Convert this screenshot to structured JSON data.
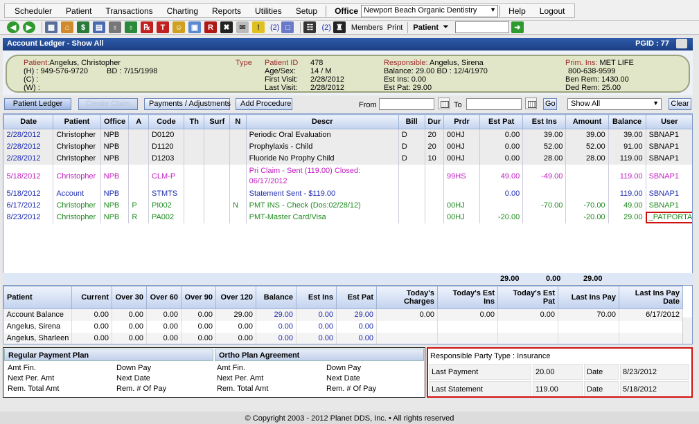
{
  "menu": {
    "items": [
      "Scheduler",
      "Patient",
      "Transactions",
      "Charting",
      "Reports",
      "Utilities",
      "Setup"
    ],
    "office_label": "Office",
    "office_value": "Newport Beach Organic Dentistry",
    "help": "Help",
    "logout": "Logout"
  },
  "toolbar": {
    "badge1": "(2)",
    "badge2": "(2)",
    "members": "Members",
    "print": "Print",
    "patient_label": "Patient",
    "patient_search_value": ""
  },
  "title": {
    "text": "Account Ledger - Show All",
    "pgid": "PGID : 77"
  },
  "patient_info": {
    "patient_label": "Patient:",
    "patient_name": "Angelus, Christopher",
    "home_phone": "(H) : 949-576-9720",
    "bd": "BD : 7/15/1998",
    "cell": "(C) :",
    "work": "(W) :",
    "type_label": "Type",
    "patient_id_label": "Patient ID",
    "patient_id": "478",
    "agesex_label": "Age/Sex:",
    "agesex": "14 / M",
    "first_visit_label": "First Visit:",
    "first_visit": "2/28/2012",
    "last_visit_label": "Last Visit:",
    "last_visit": "2/28/2012",
    "responsible_label": "Responsible:",
    "responsible_name": "Angelus, Sirena",
    "balance": "Balance: 29.00   BD : 12/4/1970",
    "est_ins": "Est Ins:  0.00",
    "est_pat": "Est Pat: 29.00",
    "prim_ins_label": "Prim. Ins:",
    "prim_ins": "MET LIFE",
    "ins_phone": "800-638-9599",
    "ben_rem": "Ben Rem: 1430.00",
    "ded_rem": "Ded Rem: 25.00"
  },
  "actions": {
    "patient_ledger": "Patient Ledger",
    "create_claim": "Create Claim",
    "payments": "Payments / Adjustments",
    "add_procedure": "Add Procedure",
    "from_label": "From",
    "from_value": "",
    "to_label": "To",
    "to_value": "",
    "go": "Go",
    "filter": "Show All",
    "clear": "Clear"
  },
  "ledger": {
    "columns": [
      "Date",
      "Patient",
      "Office",
      "A",
      "Code",
      "Th",
      "Surf",
      "N",
      "Descr",
      "Bill",
      "Dur",
      "Prdr",
      "Est Pat",
      "Est Ins",
      "Amount",
      "Balance",
      "User"
    ],
    "rows": [
      {
        "style": "gray",
        "date": "2/28/2012",
        "patient": "Christopher",
        "office": "NPB",
        "a": "",
        "code": "D0120",
        "th": "",
        "surf": "",
        "n": "",
        "descr": "Periodic Oral Evaluation",
        "descr2": "",
        "bill": "D",
        "dur": "20",
        "prdr": "00HJ",
        "estpat": "0.00",
        "estins": "39.00",
        "amount": "39.00",
        "balance": "39.00",
        "user": "SBNAP1"
      },
      {
        "style": "gray",
        "date": "2/28/2012",
        "patient": "Christopher",
        "office": "NPB",
        "a": "",
        "code": "D1120",
        "th": "",
        "surf": "",
        "n": "",
        "descr": "Prophylaxis - Child",
        "descr2": "",
        "bill": "D",
        "dur": "20",
        "prdr": "00HJ",
        "estpat": "0.00",
        "estins": "52.00",
        "amount": "52.00",
        "balance": "91.00",
        "user": "SBNAP1"
      },
      {
        "style": "gray",
        "date": "2/28/2012",
        "patient": "Christopher",
        "office": "NPB",
        "a": "",
        "code": "D1203",
        "th": "",
        "surf": "",
        "n": "",
        "descr": "Fluoride No Prophy Child",
        "descr2": "",
        "bill": "D",
        "dur": "10",
        "prdr": "00HJ",
        "estpat": "0.00",
        "estins": "28.00",
        "amount": "28.00",
        "balance": "119.00",
        "user": "SBNAP1"
      },
      {
        "style": "pink",
        "date": "5/18/2012",
        "patient": "Christopher",
        "office": "NPB",
        "a": "",
        "code": "CLM-P",
        "th": "",
        "surf": "",
        "n": "",
        "descr": "Pri Claim - Sent (119.00) Closed:",
        "descr2": "06/17/2012",
        "bill": "",
        "dur": "",
        "prdr": "99HS",
        "estpat": "49.00",
        "estins": "-49.00",
        "amount": "",
        "balance": "119.00",
        "user": "SBNAP1"
      },
      {
        "style": "blue",
        "date": "5/18/2012",
        "patient": "Account",
        "office": "NPB",
        "a": "",
        "code": "STMTS",
        "th": "",
        "surf": "",
        "n": "",
        "descr": "Statement Sent - $119.00",
        "descr2": "",
        "bill": "",
        "dur": "",
        "prdr": "",
        "estpat": "0.00",
        "estins": "",
        "amount": "",
        "balance": "119.00",
        "user": "SBNAP1"
      },
      {
        "style": "green",
        "date": "6/17/2012",
        "patient": "Christopher",
        "office": "NPB",
        "a": "P",
        "code": "PI002",
        "th": "",
        "surf": "",
        "n": "N",
        "descr": "PMT INS - Check (Dos:02/28/12)",
        "descr2": "",
        "bill": "",
        "dur": "",
        "prdr": "00HJ",
        "estpat": "",
        "estins": "-70.00",
        "amount": "-70.00",
        "balance": "49.00",
        "user": "SBNAP1"
      },
      {
        "style": "green",
        "date": "8/23/2012",
        "patient": "Christopher",
        "office": "NPB",
        "a": "R",
        "code": "PA002",
        "th": "",
        "surf": "",
        "n": "",
        "descr": "PMT-Master Card/Visa",
        "descr2": "",
        "bill": "",
        "dur": "",
        "prdr": "00HJ",
        "estpat": "-20.00",
        "estins": "",
        "amount": "-20.00",
        "balance": "29.00",
        "user": "_PATPORTA"
      }
    ],
    "totals": {
      "estpat": "29.00",
      "estins": "0.00",
      "amount": "29.00"
    }
  },
  "aging": {
    "columns": [
      "Patient",
      "Current",
      "Over 30",
      "Over 60",
      "Over 90",
      "Over 120",
      "Balance",
      "Est Ins",
      "Est Pat",
      "Today's Charges",
      "Today's Est Ins",
      "Today's Est Pat",
      "Last Ins Pay",
      "Last Ins Pay Date"
    ],
    "rows": [
      [
        "Account Balance",
        "0.00",
        "0.00",
        "0.00",
        "0.00",
        "29.00",
        "29.00",
        "0.00",
        "29.00",
        "0.00",
        "0.00",
        "0.00",
        "70.00",
        "6/17/2012"
      ],
      [
        "Angelus, Sirena",
        "0.00",
        "0.00",
        "0.00",
        "0.00",
        "0.00",
        "0.00",
        "0.00",
        "0.00",
        "",
        "",
        "",
        "",
        ""
      ],
      [
        "Angelus, Sharleen",
        "0.00",
        "0.00",
        "0.00",
        "0.00",
        "0.00",
        "0.00",
        "0.00",
        "0.00",
        "",
        "",
        "",
        "",
        ""
      ]
    ]
  },
  "plans": {
    "regular_title": "Regular Payment Plan",
    "ortho_title": "Ortho Plan Agreement",
    "amt_fin": "Amt Fin.",
    "down_pay": "Down Pay",
    "next_per_amt": "Next Per. Amt",
    "next_date": "Next Date",
    "rem_total_amt": "Rem. Total Amt",
    "rem_num_of_pay": "Rem. # Of Pay"
  },
  "responsible_party": {
    "type": "Responsible Party Type : Insurance",
    "last_payment_label": "Last Payment",
    "last_payment": "20.00",
    "date_label": "Date",
    "last_payment_date": "8/23/2012",
    "last_statement_label": "Last Statement",
    "last_statement": "119.00",
    "last_statement_date": "5/18/2012"
  },
  "footer": "© Copyright 2003 - 2012 Planet DDS, Inc. • All rights reserved",
  "colors": {
    "title_bar": "#1c3f84",
    "highlight_red": "#d01010",
    "blue_text": "#1a2ab0",
    "pink_text": "#c21cc2",
    "green_text": "#1e8a1e"
  }
}
